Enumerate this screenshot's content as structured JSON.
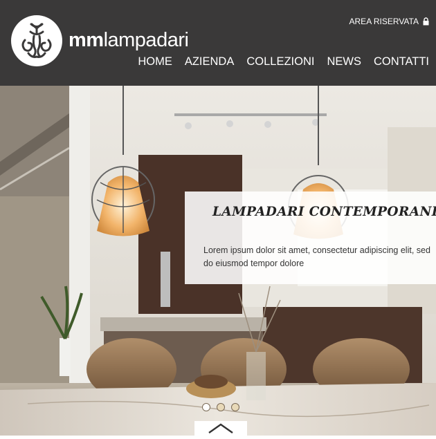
{
  "brand": {
    "bold": "mm",
    "light": "lampadari"
  },
  "header": {
    "area_label": "AREA RISERVATA"
  },
  "nav": {
    "items": [
      "HOME",
      "AZIENDA",
      "COLLEZIONI",
      "NEWS",
      "CONTATTI"
    ]
  },
  "slide": {
    "title": "LAMPADARI CONTEMPORANEI",
    "text": "Lorem ipsum dolor sit amet, consectetur adipiscing elit, sed do eiusmod tempor dolore"
  },
  "colors": {
    "header_bg": "#3a3939",
    "text_light": "#ffffff",
    "caption_bg": "#ffffff"
  },
  "icons": {
    "lock": "lock-icon",
    "logo": "logo-mark-icon",
    "scroll": "chevron-up-icon"
  },
  "slider": {
    "dot_count": 3,
    "active_index": 0
  }
}
